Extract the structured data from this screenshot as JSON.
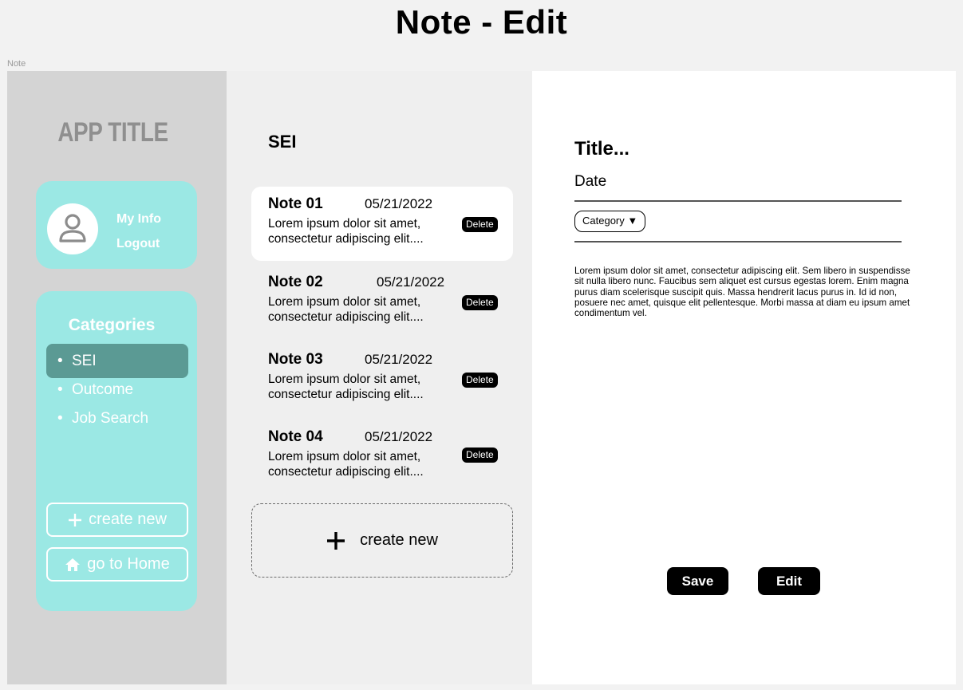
{
  "page": {
    "heading": "Note - Edit",
    "frame_label": "Note"
  },
  "sidebar": {
    "app_title": "APP TITLE",
    "user_menu": {
      "avatar_icon": "user-icon",
      "my_info": "My Info",
      "logout": "Logout"
    },
    "categories": {
      "title": "Categories",
      "items": [
        {
          "label": "SEI",
          "active": true
        },
        {
          "label": "Outcome",
          "active": false
        },
        {
          "label": "Job Search",
          "active": false
        }
      ]
    },
    "create_new": {
      "label": "create new",
      "icon": "plus-icon"
    },
    "go_home": {
      "label": "go to Home",
      "icon": "home-icon"
    }
  },
  "note_list": {
    "heading": "SEI",
    "notes": [
      {
        "title": "Note 01",
        "date": "05/21/2022",
        "snippet_line1": "Lorem ipsum dolor sit amet,",
        "snippet_line2": "consectetur adipiscing elit....",
        "delete_label": "Delete",
        "selected": true
      },
      {
        "title": "Note 02",
        "date": "05/21/2022",
        "snippet_line1": "Lorem ipsum dolor sit amet,",
        "snippet_line2": "consectetur adipiscing elit....",
        "delete_label": "Delete",
        "selected": false
      },
      {
        "title": "Note 03",
        "date": "05/21/2022",
        "snippet_line1": "Lorem ipsum dolor sit amet,",
        "snippet_line2": "consectetur adipiscing elit....",
        "delete_label": "Delete",
        "selected": false
      },
      {
        "title": "Note 04",
        "date": "05/21/2022",
        "snippet_line1": "Lorem ipsum dolor sit amet,",
        "snippet_line2": "consectetur adipiscing elit....",
        "delete_label": "Delete",
        "selected": false
      }
    ],
    "create_new": {
      "label": "create new",
      "icon": "plus-icon"
    }
  },
  "editor": {
    "title_placeholder": "Title...",
    "date_label": "Date",
    "category_select": "Category ▼",
    "body": "Lorem ipsum dolor sit amet, consectetur adipiscing elit. Sem libero in suspendisse sit nulla libero nunc. Faucibus sem aliquet est cursus egestas lorem. Enim magna purus diam scelerisque suscipit quis. Massa hendrerit lacus purus in. Id id non, posuere nec amet, quisque elit pellentesque. Morbi massa at diam eu ipsum amet condimentum vel.",
    "save_label": "Save",
    "edit_label": "Edit"
  },
  "colors": {
    "page_bg": "#f2f2f2",
    "sidebar_bg": "#d4d4d4",
    "card_accent": "#9be8e4",
    "active_category": "#5b9a94",
    "button_dark": "#000000"
  }
}
